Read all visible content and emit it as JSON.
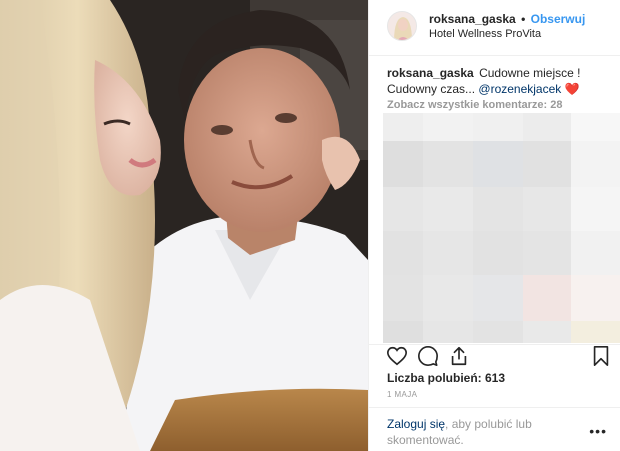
{
  "post": {
    "username": "roksana_gaska",
    "separator": "•",
    "follow_label": "Obserwuj",
    "location": "Hotel Wellness ProVita",
    "caption": {
      "username": "roksana_gaska",
      "text": "Cudowne miejsce ! Cudowny czas...",
      "mention": "@rozenekjacek",
      "emoji": "❤️"
    },
    "view_all_comments": "Zobacz wszystkie komentarze: 28",
    "likes": "Liczba polubień: 613",
    "date": "1 MAJA",
    "login_prompt": {
      "link": "Zaloguj się",
      "text": ", aby polubić lub skomentować."
    },
    "more_label": "•••"
  },
  "icons": {
    "like": "heart-outline-icon",
    "comment": "comment-bubble-icon",
    "share": "share-icon",
    "save": "bookmark-icon",
    "more": "more-options-icon"
  },
  "colors": {
    "link": "#3897f0",
    "mention": "#003569",
    "muted": "#999999",
    "text": "#262626",
    "heart": "#e0303a"
  }
}
